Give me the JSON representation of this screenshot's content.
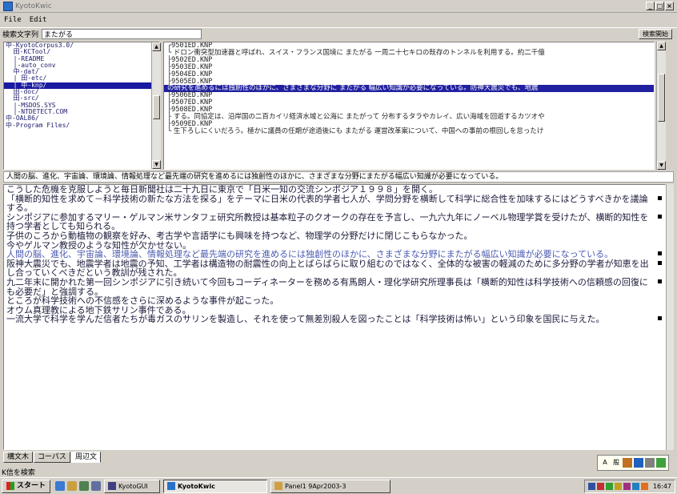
{
  "window": {
    "title": "KyotoKwic"
  },
  "menu": {
    "file": "File",
    "edit": "Edit"
  },
  "search": {
    "label": "検索文字列",
    "value": "またがる",
    "button": "検索開始"
  },
  "tree": [
    "中-KyotoCorpus3.0/",
    "  田-KCTool/",
    "  |-README",
    "  |-auto_conv",
    "  中-dat/",
    "  | 田-etc/",
    "  | 中-knp/",
    "  田-doc/",
    "  田-src/",
    "  |-MSDOS.SYS",
    "  |-NTDETECT.COM",
    "中-OAL86/",
    "中-Program Files/"
  ],
  "tree_selected": 6,
  "kwic": [
    {
      "kind": "file",
      "text": "  ┌9501ED.KNP"
    },
    {
      "kind": "text",
      "text": "  └ ドロン衝突型加速器と呼ばれ、スイス・フランス国境に またがる 一周二十七キロの既存のトンネルを利用する。約二千億"
    },
    {
      "kind": "file",
      "text": "  ├9502ED.KNP"
    },
    {
      "kind": "file",
      "text": "  ├9503ED.KNP"
    },
    {
      "kind": "file",
      "text": "  ├9504ED.KNP"
    },
    {
      "kind": "file",
      "text": "  ├9505ED.KNP"
    },
    {
      "kind": "sel",
      "text": "  の研究を進めるには独創性のほかに、さまざまな分野に またがる 幅広い知識が必要になっている。防神大震災でも、地震"
    },
    {
      "kind": "file",
      "text": "  ├9506ED.KNP"
    },
    {
      "kind": "file",
      "text": "  ├9507ED.KNP"
    },
    {
      "kind": "file",
      "text": "  ├9508ED.KNP"
    },
    {
      "kind": "text",
      "text": "  ├ する。同協定は、沿岸国の二百カイリ経済水域と公海に またがって 分布するタラやカレイ、広い海域を回遊するカツオや"
    },
    {
      "kind": "file",
      "text": "  ├9509ED.KNP"
    },
    {
      "kind": "text",
      "text": "  └ 生下ろしにくいだろう。極かに議員の任期が途過後にも またがる 運営改革案について、中国への事前の根回しを怠ったけ"
    }
  ],
  "context_line": "人間の脳、進化、宇宙論、環境論、情報処理など最先端の研究を進めるには独創性のほかに、さまざまな分野にまたがる幅広い知識が必要になっている。",
  "document": [
    {
      "text": "こうした危機を克服しようと毎日新聞社は二十九日に東京で「日米一知の交流シンポジア１９９８」を開く。",
      "hl": false,
      "mark": false
    },
    {
      "text": "「横断的知性を求めて－科学技術の新たな方法を探る」をテーマに日米の代表的学者七人が、学問分野を横断して科学に総合性を加味するにはどうすべきかを議論する。",
      "hl": false,
      "mark": true
    },
    {
      "text": "シンポジアに参加するマリー・ゲルマン米サンタフェ研究所教授は基本粒子のクオークの存在を予言し、一九六九年にノーベル物理学賞を受けたが、横断的知性を持つ学者としても知られる。",
      "hl": false,
      "mark": true
    },
    {
      "text": "子供のころから動植物の観察を好み、考古学や言語学にも興味を持つなど、物理学の分野だけに閉じこもらなかった。",
      "hl": false,
      "mark": false
    },
    {
      "text": "今やゲルマン教授のような知性が欠かせない。",
      "hl": false,
      "mark": false
    },
    {
      "text": "人間の脳、進化、宇宙論、環境論、情報処理など最先端の研究を進めるには独創性のほかに、さまざまな分野にまたがる幅広い知識が必要になっている。",
      "hl": true,
      "mark": true
    },
    {
      "text": "阪神大震災でも、地震学者は地震の予知、工学者は構造物の耐震性の向上とばらばらに取り組むのではなく、全体的な被害の軽減のために多分野の学者が知恵を出し合っていくべきだという教訓が残された。",
      "hl": false,
      "mark": true
    },
    {
      "text": "九二年末に開かれた第一回シンポジアに引き続いて今回もコーディネーターを務める有馬朗人・理化学研究所理事長は「横断的知性は科学技術への信頼感の回復にも必要だ」と強調する。",
      "hl": false,
      "mark": true
    },
    {
      "text": "ところが科学技術への不信感をさらに深めるような事件が起こった。",
      "hl": false,
      "mark": false
    },
    {
      "text": "オウム真理教による地下鉄サリン事件である。",
      "hl": false,
      "mark": false
    },
    {
      "text": "一流大学で科学を学んだ信者たちが毒ガスのサリンを製造し、それを使って無差別殺人を図ったことは「科学技術は怖い」という印象を国民に与えた。",
      "hl": false,
      "mark": true
    }
  ],
  "tabs": [
    "構文木",
    "コーパス",
    "周辺文"
  ],
  "active_tab": 2,
  "status": "K信を検索",
  "taskbar": {
    "start": "スタート",
    "tasks": [
      "KyotoGUI",
      "KyotoKwic",
      "Panel1 9Apr2003-3"
    ],
    "clock": "16:47"
  },
  "colors": {
    "selection": "#2020a0",
    "highlight_text": "#4a5ab0",
    "accent": "#2b6fc8"
  }
}
